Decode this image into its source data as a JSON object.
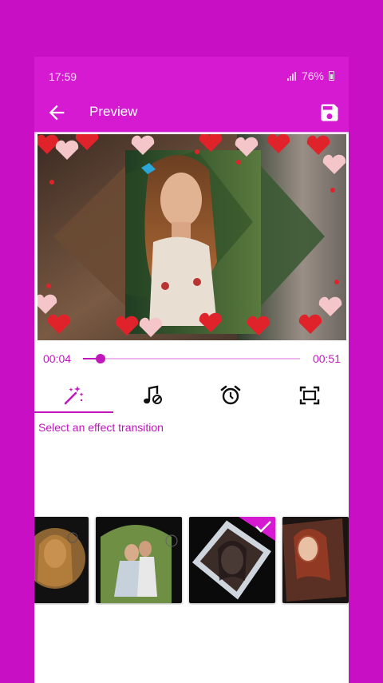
{
  "status_bar": {
    "time": "17:59",
    "battery": "76%"
  },
  "toolbar": {
    "title": "Preview",
    "back_icon": "arrow-back-icon",
    "save_icon": "save-icon"
  },
  "player": {
    "current_time": "00:04",
    "total_time": "00:51",
    "progress": 0.08
  },
  "tabs": [
    {
      "icon": "magic-wand-icon",
      "active": true
    },
    {
      "icon": "music-icon",
      "active": false
    },
    {
      "icon": "alarm-clock-icon",
      "active": false
    },
    {
      "icon": "frame-icon",
      "active": false
    }
  ],
  "hint": "Select an effect transition",
  "transitions": [
    {
      "name": "circle-reveal",
      "selected": false
    },
    {
      "name": "arc-wipe",
      "selected": false
    },
    {
      "name": "diamond-tilt",
      "selected": true
    },
    {
      "name": "cube-slide",
      "selected": false
    }
  ],
  "colors": {
    "accent": "#c017bd",
    "app_bar": "#d51ad1",
    "background": "#c90fc4"
  }
}
